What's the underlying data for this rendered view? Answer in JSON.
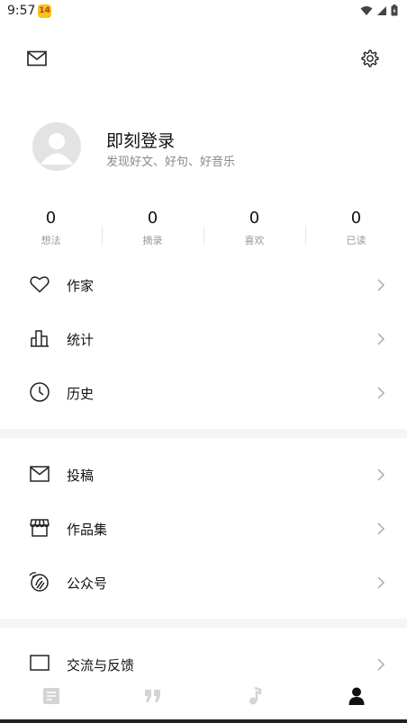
{
  "status": {
    "time": "9:57",
    "badge": "14"
  },
  "header": {
    "mail_icon": "mail-icon",
    "settings_icon": "gear-icon"
  },
  "profile": {
    "name": "即刻登录",
    "subtitle": "发现好文、好句、好音乐"
  },
  "stats": [
    {
      "value": "0",
      "label": "想法"
    },
    {
      "value": "0",
      "label": "摘录"
    },
    {
      "value": "0",
      "label": "喜欢"
    },
    {
      "value": "0",
      "label": "已读"
    }
  ],
  "menu": [
    {
      "label": "作家",
      "icon": "heart-icon"
    },
    {
      "label": "统计",
      "icon": "bar-chart-icon"
    },
    {
      "label": "历史",
      "icon": "clock-icon"
    },
    {
      "label": "投稿",
      "icon": "envelope-icon"
    },
    {
      "label": "作品集",
      "icon": "store-icon"
    },
    {
      "label": "公众号",
      "icon": "wechat-icon"
    },
    {
      "label": "交流与反馈",
      "icon": "message-icon"
    }
  ],
  "bottom_nav": [
    {
      "icon": "article-icon",
      "active": false
    },
    {
      "icon": "quote-icon",
      "active": false
    },
    {
      "icon": "music-note-icon",
      "active": false
    },
    {
      "icon": "person-icon",
      "active": true
    }
  ],
  "colors": {
    "active": "#111111",
    "inactive": "#d4d4d4",
    "muted_text": "#888888",
    "divider": "#f5f5f5"
  }
}
